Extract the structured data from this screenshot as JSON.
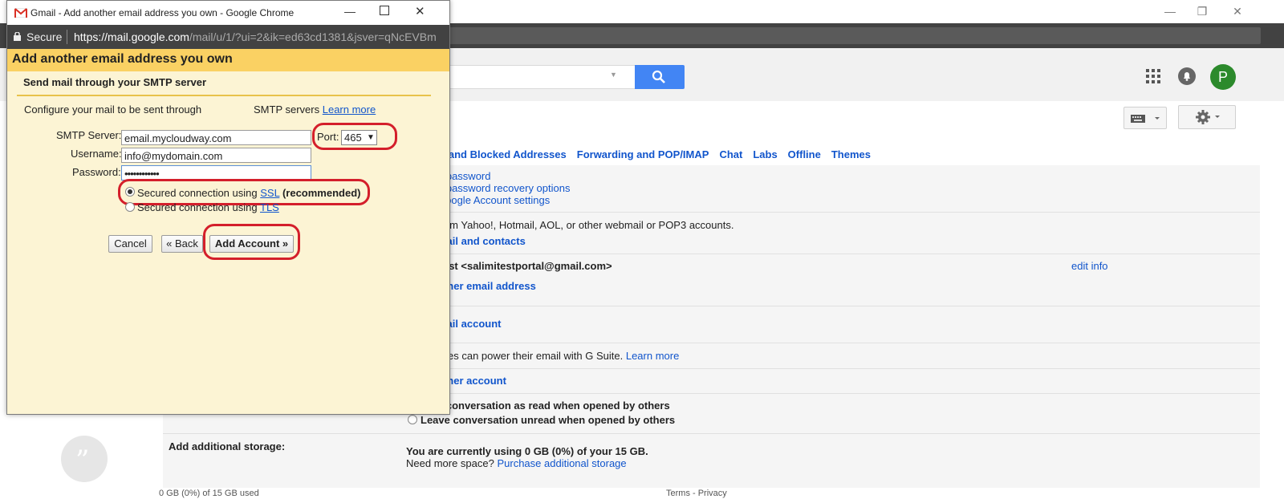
{
  "background": {
    "gmail_tabs": [
      "s and Blocked Addresses",
      "Forwarding and POP/IMAP",
      "Chat",
      "Labs",
      "Offline",
      "Themes"
    ],
    "accounts": {
      "change_password": "e password",
      "recovery": "e password recovery options",
      "google_settings": "Google Account settings"
    },
    "import_text": "from Yahoo!, Hotmail, AOL, or other webmail or POP3 accounts.",
    "import_link": "mail and contacts",
    "send_as_name": "Test <salimitestportal@gmail.com>",
    "edit_info": "edit info",
    "add_another": "other email address",
    "check_mail": "mail account",
    "gsuite_text": "sses can power their email with G Suite.",
    "gsuite_learn": "Learn more",
    "grant_access": "other account",
    "mark_read": "k conversation as read when opened by others",
    "leave_unread": "Leave conversation unread when opened by others",
    "storage_label": "Add additional storage:",
    "storage_usage": "You are currently using 0 GB (0%) of your 15 GB.",
    "need_more": "Need more space?",
    "purchase": "Purchase additional storage",
    "avatar_letter": "P",
    "footer_left": "0 GB (0%) of 15 GB used",
    "footer_right": "Terms - Privacy"
  },
  "popup": {
    "window_title": "Gmail - Add another email address you own - Google Chrome",
    "secure_label": "Secure",
    "url_host": "https://mail.google.com",
    "url_path": "/mail/u/1/?ui=2&ik=ed63cd1381&jsver=qNcEVBm",
    "header": "Add another email address you own",
    "subheader": "Send mail through your SMTP server",
    "configure_text": "Configure your mail to be sent through",
    "smtp_servers_text": "SMTP servers",
    "learn_more": "Learn more",
    "smtp_server_label": "SMTP Server:",
    "smtp_server_value": "email.mycloudway.com",
    "port_label": "Port:",
    "port_value": "465",
    "username_label": "Username:",
    "username_value": "info@mydomain.com",
    "password_label": "Password:",
    "password_value": "••••••••••••",
    "ssl_prefix": "Secured connection using",
    "ssl_link": "SSL",
    "ssl_suffix": "(recommended)",
    "tls_prefix": "Secured connection using",
    "tls_link": "TLS",
    "cancel": "Cancel",
    "back": "« Back",
    "add_account": "Add Account »"
  }
}
